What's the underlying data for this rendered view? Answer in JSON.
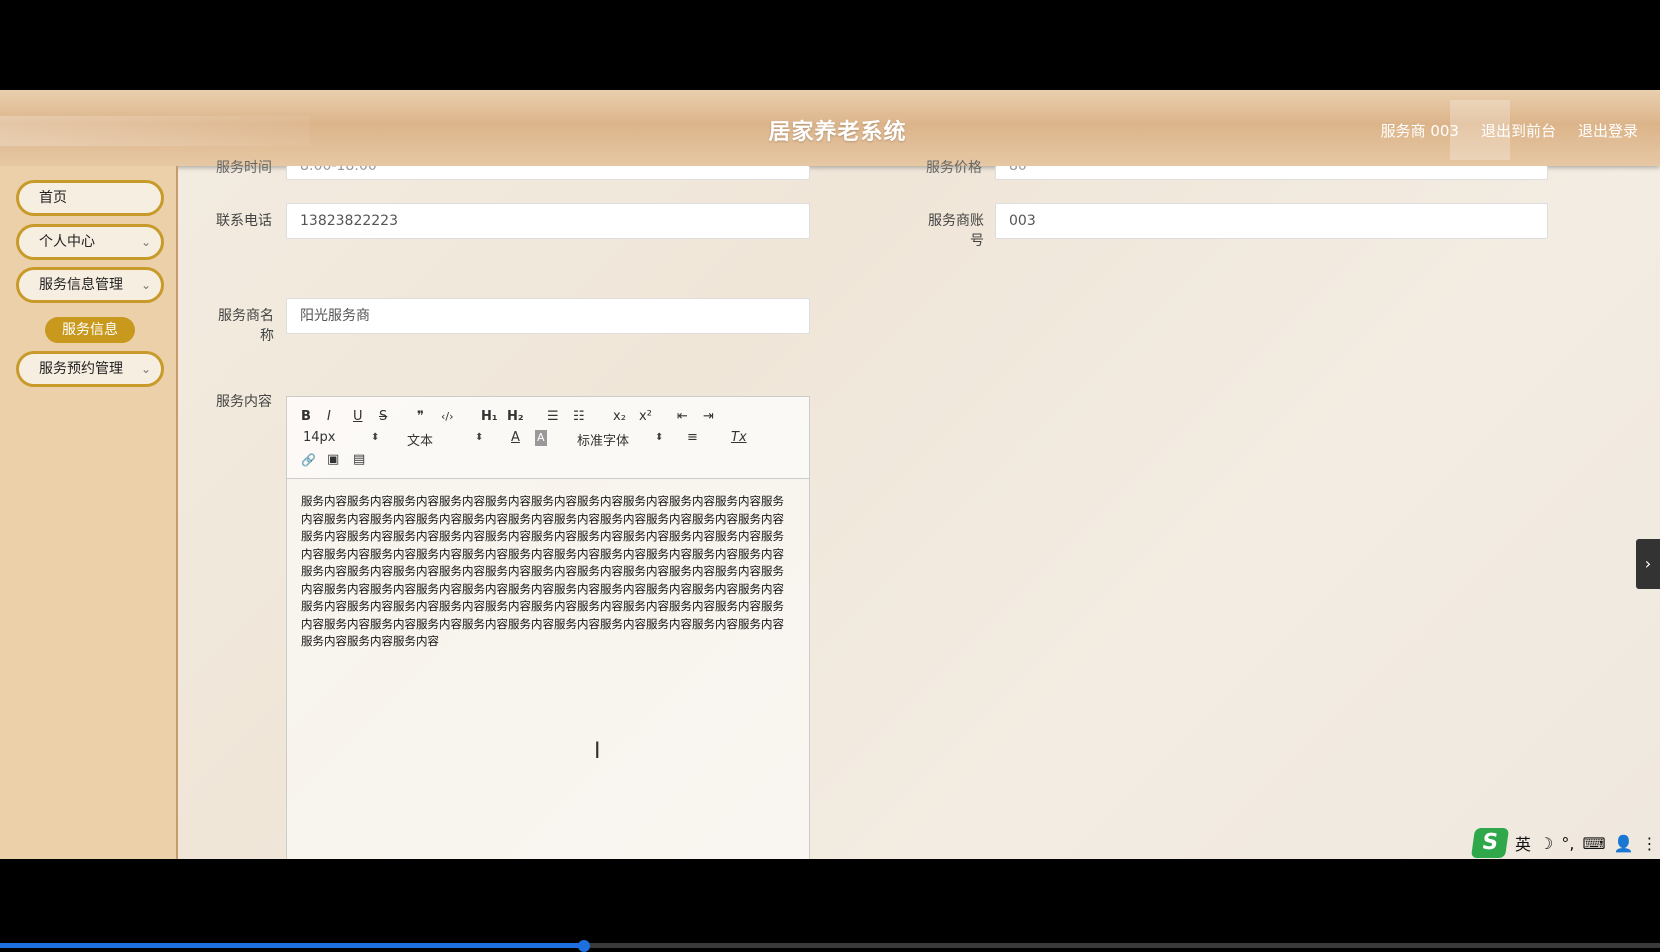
{
  "header": {
    "app_title": "居家养老系统",
    "user_label": "服务商 003",
    "back_to_front": "退出到前台",
    "logout": "退出登录"
  },
  "sidebar": {
    "items": [
      {
        "label": "首页",
        "has_dropdown": false
      },
      {
        "label": "个人中心",
        "has_dropdown": true
      },
      {
        "label": "服务信息管理",
        "has_dropdown": true
      },
      {
        "label": "服务预约管理",
        "has_dropdown": true
      }
    ],
    "active_sub_item": "服务信息",
    "chevron": "⌄"
  },
  "form": {
    "service_time": {
      "label": "服务时间",
      "value": "8:00-18:00"
    },
    "service_price": {
      "label": "服务价格",
      "value": "80"
    },
    "phone": {
      "label": "联系电话",
      "value": "13823822223"
    },
    "provider_account": {
      "label": "服务商账号",
      "value": "003"
    },
    "provider_name": {
      "label": "服务商名称",
      "value": "阳光服务商"
    },
    "service_content_label": "服务内容"
  },
  "editor": {
    "toolbar": {
      "bold": "B",
      "italic": "I",
      "underline": "U",
      "strike": "S",
      "blockquote": "❞",
      "code": "‹/›",
      "h1": "H₁",
      "h2": "H₂",
      "ordered_list": "☰",
      "bullet_list": "☷",
      "subscript": "x₂",
      "superscript": "x²",
      "outdent": "⇤",
      "indent": "⇥",
      "size_select": "14px",
      "header_select": "文本",
      "font_color": "A",
      "bg_color": "A",
      "font_select": "标准字体",
      "align": "≡",
      "clean": "Tx",
      "link": "🔗",
      "image": "▣",
      "video": "▤"
    },
    "content": "服务内容服务内容服务内容服务内容服务内容服务内容服务内容服务内容服务内容服务内容服务内容服务内容服务内容服务内容服务内容服务内容服务内容服务内容服务内容服务内容服务内容服务内容服务内容服务内容服务内容服务内容服务内容服务内容服务内容服务内容服务内容服务内容服务内容服务内容服务内容服务内容服务内容服务内容服务内容服务内容服务内容服务内容服务内容服务内容服务内容服务内容服务内容服务内容服务内容服务内容服务内容服务内容服务内容服务内容服务内容服务内容服务内容服务内容服务内容服务内容服务内容服务内容服务内容服务内容服务内容服务内容服务内容服务内容服务内容服务内容服务内容服务内容服务内容服务内容服务内容服务内容服务内容服务内容服务内容服务内容服务内容服务内容服务内容服务内容服务内容服务内容服务内容"
  },
  "side_tab_arrow": "›",
  "ime": {
    "logo": "S",
    "mode": "英",
    "icons": [
      "☽",
      "°,",
      "⌨",
      "👤",
      "⋮"
    ]
  },
  "video_progress": 0.352
}
